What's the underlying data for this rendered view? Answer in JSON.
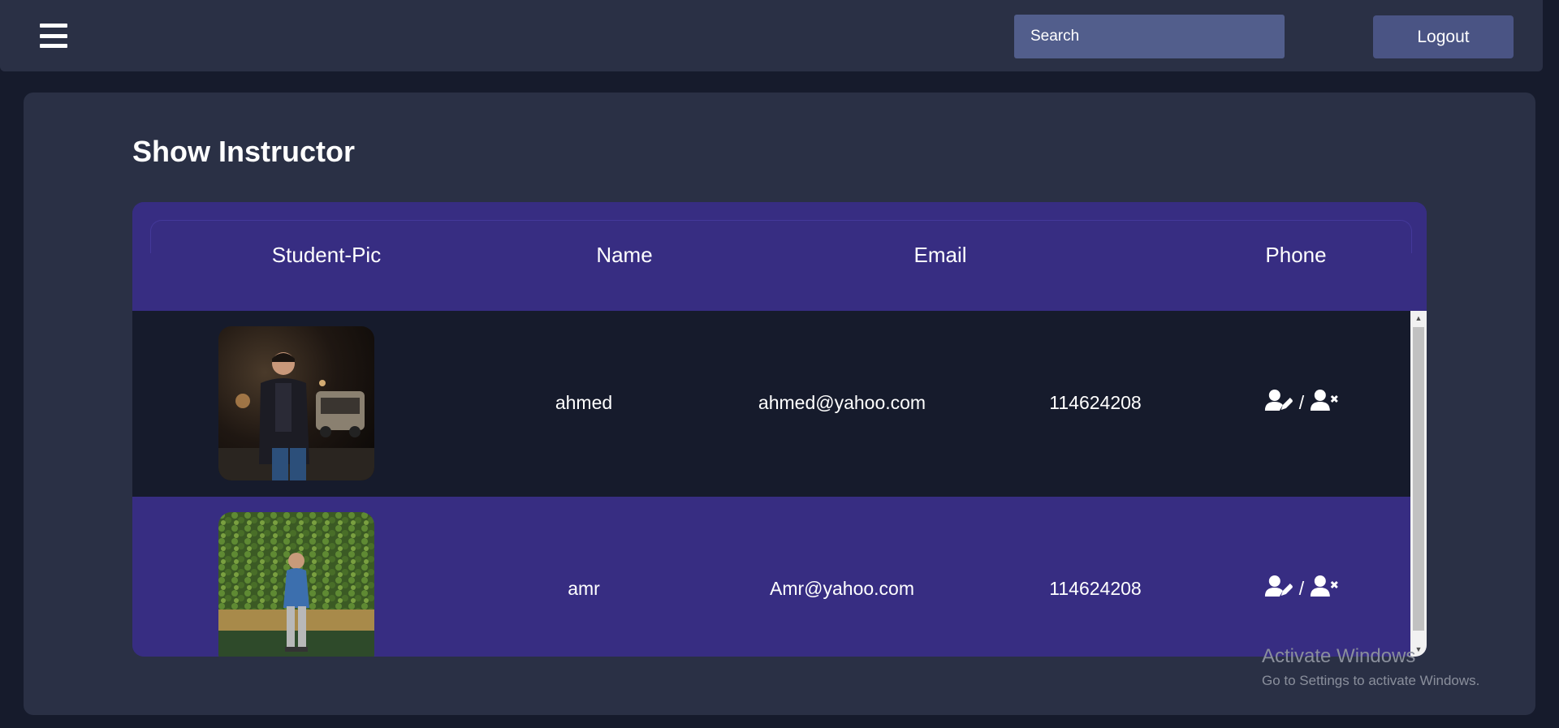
{
  "header": {
    "menu_icon": "hamburger-menu-icon",
    "search": {
      "placeholder": "Search",
      "value": ""
    },
    "logout_label": "Logout"
  },
  "page": {
    "title": "Show Instructor"
  },
  "table": {
    "columns": [
      "Student-Pic",
      "Name",
      "Email",
      "Phone"
    ],
    "rows": [
      {
        "pic": "instructor-photo-night-street",
        "name": "ahmed",
        "email": "ahmed@yahoo.com",
        "phone": "114624208",
        "separator": "/"
      },
      {
        "pic": "instructor-photo-green-wall",
        "name": "amr",
        "email": "Amr@yahoo.com",
        "phone": "114624208",
        "separator": "/"
      }
    ],
    "action_icons": [
      "user-edit-icon",
      "user-delete-icon"
    ]
  },
  "watermark": {
    "title": "Activate Windows",
    "subtitle": "Go to Settings to activate Windows."
  },
  "colors": {
    "background": "#161b2c",
    "panel": "#2a3045",
    "table_header": "#372d82",
    "row_dark": "#161b2c",
    "row_purple": "#372d82",
    "search_bg": "#525e8c",
    "logout_bg": "#4a5484"
  }
}
